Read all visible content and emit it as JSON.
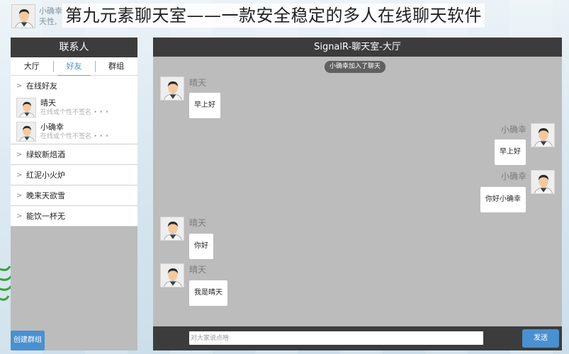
{
  "header": {
    "banner": "第九元素聊天室——一款安全稳定的多人在线聊天软件",
    "user_name": "小确幸",
    "user_sub": "天性,"
  },
  "contacts": {
    "title": "联系人",
    "tabs": [
      "大厅",
      "好友",
      "群组"
    ],
    "active_tab": "好友",
    "groups": [
      {
        "name": "在线好友",
        "friends": [
          {
            "name": "晴天",
            "signature": "在线或个性不签名 • • •"
          },
          {
            "name": "小确幸",
            "signature": "在线或个性不签名 • • •"
          }
        ]
      },
      {
        "name": "绿蚁新焙酒"
      },
      {
        "name": "红泥小火炉"
      },
      {
        "name": "晚来天欲雪"
      },
      {
        "name": "能饮一杯无"
      }
    ],
    "create_group_label": "创建群组"
  },
  "chat": {
    "title": "SignalR-聊天室-大厅",
    "system_notice": "小确幸加入了聊天",
    "messages": [
      {
        "sender": "晴天",
        "side": "left",
        "text": "早上好"
      },
      {
        "sender": "小确幸",
        "side": "right",
        "text": "早上好"
      },
      {
        "sender": "小确幸",
        "side": "right",
        "text": "你好小确幸"
      },
      {
        "sender": "晴天",
        "side": "left",
        "text": "你好"
      },
      {
        "sender": "晴天",
        "side": "left",
        "text": "我是晴天"
      }
    ],
    "input_placeholder": "对大家说点啥",
    "send_label": "发送"
  },
  "colors": {
    "header_bar": "#3c3c3c",
    "panel_bg": "#bcbcbc",
    "accent_button": "#4a90d0",
    "active_tab_text": "#4a90c8"
  },
  "icons": [
    "user-avatar-icon",
    "chevron-right-icon"
  ]
}
